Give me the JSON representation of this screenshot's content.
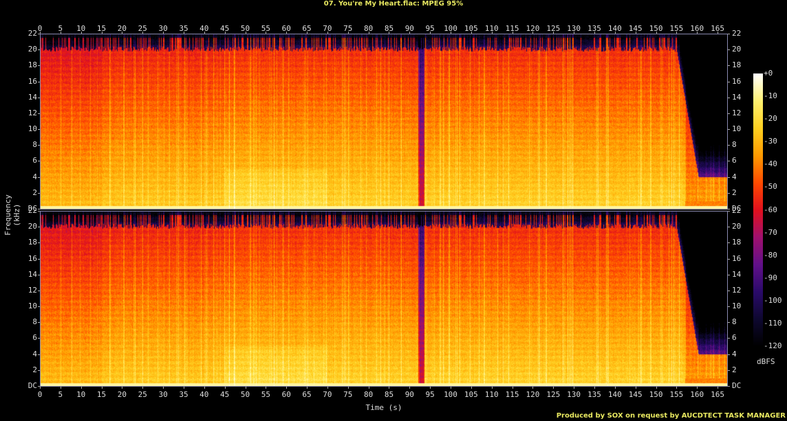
{
  "chart_data": {
    "type": "heatmap",
    "title": "07. You're My Heart.flac: MPEG 95%",
    "xlabel": "Time (s)",
    "ylabel": "Frequency (kHz)",
    "xlim": [
      0,
      167.5
    ],
    "ylim": [
      0,
      22
    ],
    "x_ticks": [
      0,
      5,
      10,
      15,
      20,
      25,
      30,
      35,
      40,
      45,
      50,
      55,
      60,
      65,
      70,
      75,
      80,
      85,
      90,
      95,
      100,
      105,
      110,
      115,
      120,
      125,
      130,
      135,
      140,
      145,
      150,
      155,
      160,
      165
    ],
    "y_ticks": [
      "DC",
      "2",
      "4",
      "6",
      "8",
      "10",
      "12",
      "14",
      "16",
      "18",
      "20",
      "22"
    ],
    "channels": 2,
    "colorbar": {
      "unit": "dBFS",
      "range": [
        -120,
        0
      ],
      "ticks": [
        "+0",
        "-10",
        "-20",
        "-30",
        "-40",
        "-50",
        "-60",
        "-70",
        "-80",
        "-90",
        "-100",
        "-110",
        "-120"
      ],
      "colormap": [
        "#000000",
        "#0e0830",
        "#2a0a6a",
        "#62108a",
        "#a0106e",
        "#e0101e",
        "#ff4a00",
        "#ff9a00",
        "#ffd020",
        "#fff070",
        "#ffffff"
      ]
    },
    "description_features": {
      "lowpass_cutoff_khz": 20,
      "fade_out_start_s": 157,
      "dropout_s": 93
    }
  },
  "footer": "Produced by SOX on request by AUCDTECT TASK MANAGER"
}
